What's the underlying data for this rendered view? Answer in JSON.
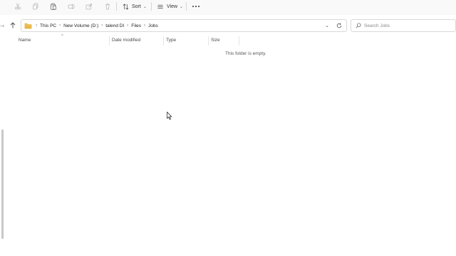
{
  "toolbar": {
    "icons": [
      "cut-icon",
      "copy-icon",
      "paste-icon",
      "rename-icon",
      "share-icon",
      "delete-icon"
    ],
    "sort_label": "Sort",
    "view_label": "View",
    "more_icon": "more-icon"
  },
  "address": {
    "crumbs": [
      "This PC",
      "New Volume (D:)",
      "talend DI",
      "Files",
      "Jobs"
    ]
  },
  "search": {
    "placeholder": "Search Jobs"
  },
  "columns": {
    "name": "Name",
    "date_modified": "Date modified",
    "type": "Type",
    "size": "Size"
  },
  "content": {
    "empty_message": "This folder is empty."
  },
  "colors": {
    "folder": "#e8b84a",
    "toolbar_bg": "#f9f9f9",
    "border": "#d9d9d9"
  }
}
